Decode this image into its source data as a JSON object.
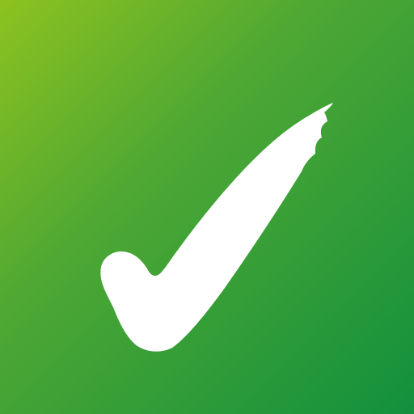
{
  "icon": {
    "name": "checkmark-icon",
    "background_gradient": {
      "start": "#8DC21F",
      "mid": "#4FA833",
      "end": "#12903D"
    },
    "mark_color": "#FFFFFF"
  }
}
